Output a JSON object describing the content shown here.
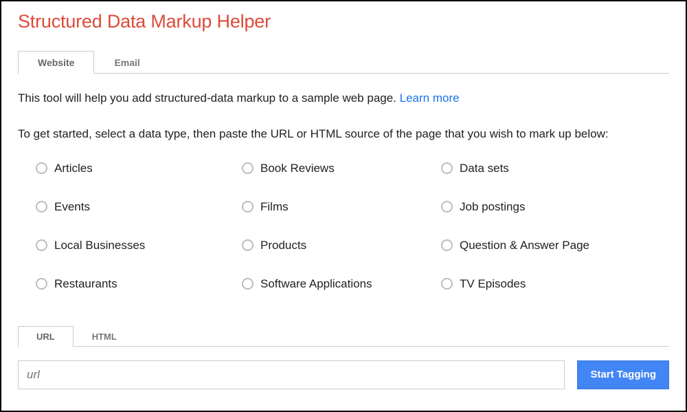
{
  "title": "Structured Data Markup Helper",
  "top_tabs": {
    "website": "Website",
    "email": "Email"
  },
  "intro": {
    "part1": "This tool will help you add structured-data markup to a sample web page. ",
    "learn_more": "Learn more",
    "part2": "To get started, select a data type, then paste the URL or HTML source of the page that you wish to mark up below:"
  },
  "data_types": {
    "articles": "Articles",
    "book_reviews": "Book Reviews",
    "data_sets": "Data sets",
    "events": "Events",
    "films": "Films",
    "job_postings": "Job postings",
    "local_businesses": "Local Businesses",
    "products": "Products",
    "qa_page": "Question & Answer Page",
    "restaurants": "Restaurants",
    "software_apps": "Software Applications",
    "tv_episodes": "TV Episodes"
  },
  "lower_tabs": {
    "url": "URL",
    "html": "HTML"
  },
  "url_placeholder": "url",
  "start_button": "Start Tagging"
}
